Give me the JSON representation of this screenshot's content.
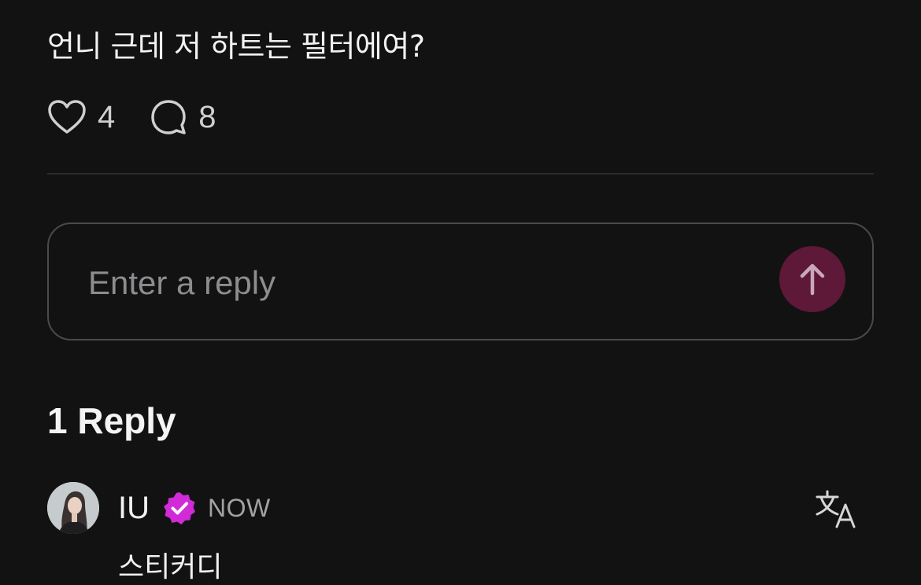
{
  "post": {
    "text": "언니 근데 저 하트는 필터에여?",
    "likes": "4",
    "comments": "8"
  },
  "reply_box": {
    "placeholder": "Enter a reply"
  },
  "replies": {
    "heading": "1 Reply",
    "items": [
      {
        "author": "IU",
        "timestamp": "NOW",
        "text": "스티커디"
      }
    ]
  },
  "colors": {
    "background": "#121213",
    "send_button": "#5e1838",
    "verified_badge": "#d02bd6",
    "divider": "#2a2a2b"
  },
  "icons": {
    "like": "heart-outline-icon",
    "comment": "speech-bubble-icon",
    "send": "arrow-up-icon",
    "verified": "verified-badge-icon",
    "translate": "translate-icon"
  }
}
